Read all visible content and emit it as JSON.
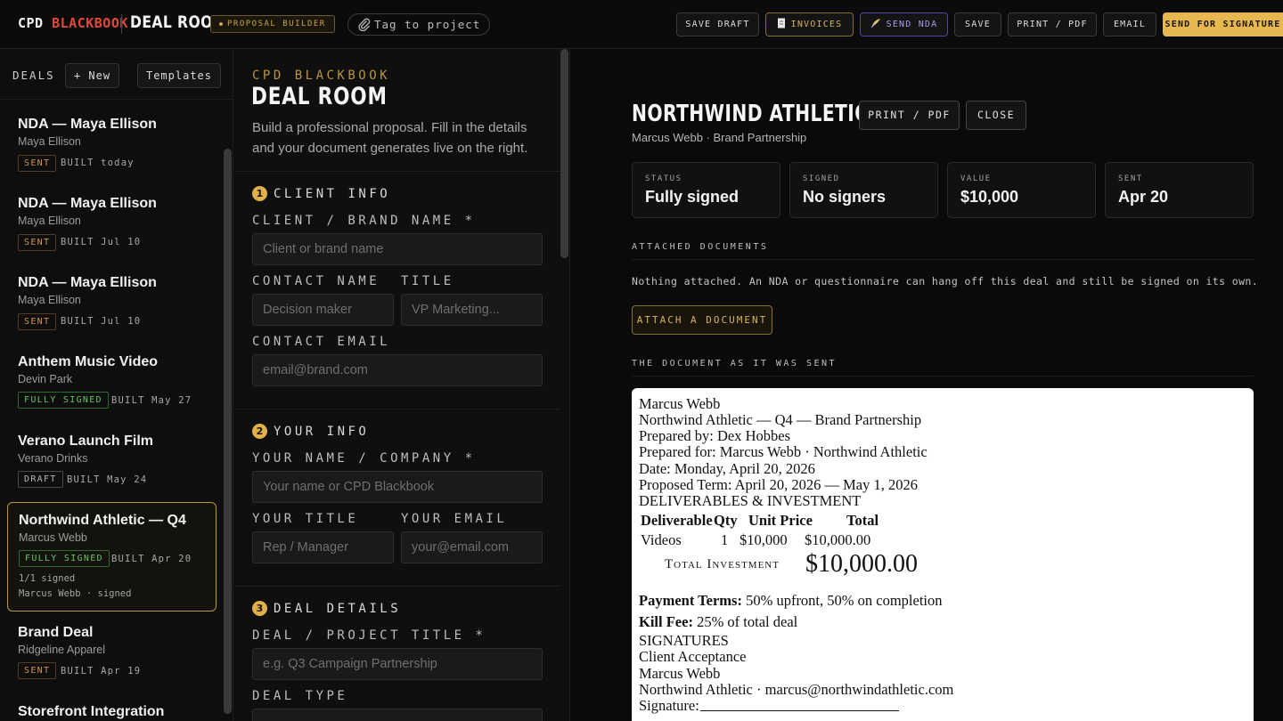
{
  "topbar": {
    "brand_a": "CPD",
    "brand_b": "BLACKBOOK",
    "room": "DEAL ROOM",
    "badge": "PROPOSAL BUILDER",
    "tag": "Tag to project",
    "buttons": {
      "save_draft": "SAVE DRAFT",
      "invoices": "INVOICES",
      "send_nda": "SEND NDA",
      "save": "SAVE",
      "print_pdf": "PRINT / PDF",
      "email": "EMAIL",
      "send_sig": "SEND FOR SIGNATURE"
    }
  },
  "sidebar": {
    "label": "DEALS",
    "new_btn": "+ New",
    "templates_btn": "Templates",
    "deals": [
      {
        "title": "NDA — Maya Ellison",
        "client": "Maya Ellison",
        "status": "SENT",
        "built": "BUILT today"
      },
      {
        "title": "NDA — Maya Ellison",
        "client": "Maya Ellison",
        "status": "SENT",
        "built": "BUILT Jul 10"
      },
      {
        "title": "NDA — Maya Ellison",
        "client": "Maya Ellison",
        "status": "SENT",
        "built": "BUILT Jul 10"
      },
      {
        "title": "Anthem Music Video",
        "client": "Devin Park",
        "status": "FULLY SIGNED",
        "built": "BUILT May 27"
      },
      {
        "title": "Verano Launch Film",
        "client": "Verano Drinks",
        "status": "DRAFT",
        "built": "BUILT May 24"
      },
      {
        "title": "Northwind Athletic — Q4",
        "client": "Marcus Webb",
        "status": "FULLY SIGNED",
        "built": "BUILT Apr 20",
        "signed_count": "1/1 signed",
        "signer": "Marcus Webb · signed"
      },
      {
        "title": "Brand Deal",
        "client": "Ridgeline Apparel",
        "status": "SENT",
        "built": "BUILT Apr 19"
      },
      {
        "title": "Storefront Integration",
        "client": "",
        "status": "",
        "built": ""
      }
    ]
  },
  "form": {
    "kicker": "CPD BLACKBOOK",
    "title": "DEAL ROOM",
    "intro": "Build a professional proposal. Fill in the details and your document generates live on the right.",
    "sections": {
      "client": {
        "num": "1",
        "title": "CLIENT INFO"
      },
      "you": {
        "num": "2",
        "title": "YOUR INFO"
      },
      "deal": {
        "num": "3",
        "title": "DEAL DETAILS"
      }
    },
    "labels": {
      "brand": "CLIENT / BRAND NAME *",
      "contact_name": "CONTACT NAME",
      "title": "TITLE",
      "contact_email": "CONTACT EMAIL",
      "your_name": "YOUR NAME / COMPANY *",
      "your_title": "YOUR TITLE",
      "your_email": "YOUR EMAIL",
      "deal_title": "DEAL / PROJECT TITLE *",
      "deal_type": "DEAL TYPE"
    },
    "placeholders": {
      "brand": "Client or brand name",
      "contact_name": "Decision maker",
      "title": "VP Marketing...",
      "contact_email": "email@brand.com",
      "your_name": "Your name or CPD Blackbook",
      "your_title": "Rep / Manager",
      "your_email": "your@email.com",
      "deal_title": "e.g. Q3 Campaign Partnership"
    }
  },
  "detail": {
    "title": "NORTHWIND ATHLETIC — Q4",
    "subtitle": "Marcus Webb · Brand Partnership",
    "print_btn": "PRINT / PDF",
    "close_btn": "CLOSE",
    "stats": [
      {
        "label": "STATUS",
        "value": "Fully signed"
      },
      {
        "label": "SIGNED",
        "value": "No signers"
      },
      {
        "label": "VALUE",
        "value": "$10,000"
      },
      {
        "label": "SENT",
        "value": "Apr 20"
      }
    ],
    "attached_label": "ATTACHED DOCUMENTS",
    "attached_note": "Nothing attached. An NDA or questionnaire can hang off this deal and still be signed on its own.",
    "attach_btn": "ATTACH A DOCUMENT",
    "sent_label": "THE DOCUMENT AS IT WAS SENT"
  },
  "document": {
    "line1": "Marcus Webb",
    "line2": "Northwind Athletic — Q4 — Brand Partnership",
    "line3": "Prepared by: Dex Hobbes",
    "line4": "Prepared for: Marcus Webb · Northwind Athletic",
    "line5": "Date: Monday, April 20, 2026",
    "line6": "Proposed Term: April 20, 2026 — May 1, 2026",
    "line7": "DELIVERABLES & INVESTMENT",
    "table_headers": [
      "Deliverable",
      "Qty",
      "Unit Price",
      "Total"
    ],
    "table_row": [
      "Videos",
      "1",
      "$10,000",
      "$10,000.00"
    ],
    "total_label": "Total Investment",
    "total_value": "$10,000.00",
    "payment_label": "Payment Terms:",
    "payment_value": " 50% upfront, 50% on completion",
    "kill_label": "Kill Fee:",
    "kill_value": " 25% of total deal",
    "sig_head": "SIGNATURES",
    "sig_sub": "Client Acceptance",
    "sig_name": "Marcus Webb",
    "sig_org": "Northwind Athletic · marcus@northwindathletic.com",
    "sig_label": "Signature:"
  }
}
